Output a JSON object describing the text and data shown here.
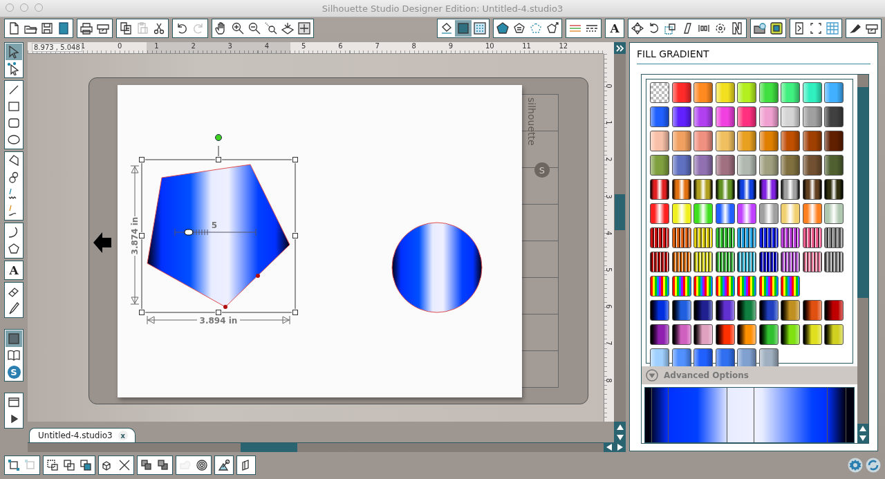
{
  "window": {
    "title": "Silhouette Studio Designer Edition: Untitled-4.studio3"
  },
  "toolbar": {
    "left_groups": [
      {
        "buttons": [
          {
            "kind": "new",
            "selected": false,
            "disabled": false
          },
          {
            "kind": "open",
            "selected": false,
            "disabled": false
          },
          {
            "kind": "save",
            "selected": false,
            "disabled": false
          },
          {
            "kind": "sd",
            "selected": false,
            "disabled": false
          }
        ]
      },
      {
        "buttons": [
          {
            "kind": "print",
            "selected": false,
            "disabled": false
          },
          {
            "kind": "cutter",
            "selected": false,
            "disabled": false
          }
        ]
      },
      {
        "buttons": [
          {
            "kind": "copy",
            "selected": false,
            "disabled": false
          },
          {
            "kind": "paste",
            "selected": false,
            "disabled": true
          },
          {
            "kind": "cut",
            "selected": false,
            "disabled": false
          }
        ]
      },
      {
        "buttons": [
          {
            "kind": "undo",
            "selected": false,
            "disabled": false
          },
          {
            "kind": "redo",
            "selected": false,
            "disabled": true
          }
        ]
      },
      {
        "buttons": [
          {
            "kind": "hand",
            "selected": false,
            "disabled": false
          },
          {
            "kind": "zoom_in",
            "selected": false,
            "disabled": false
          },
          {
            "kind": "zoom_out",
            "selected": false,
            "disabled": false
          },
          {
            "kind": "zoom_select",
            "selected": false,
            "disabled": false
          },
          {
            "kind": "zoom_fit",
            "selected": false,
            "disabled": false
          },
          {
            "kind": "fit_page",
            "selected": false,
            "disabled": false
          }
        ]
      }
    ],
    "right_groups": [
      {
        "buttons": [
          {
            "kind": "paint_bucket",
            "selected": false,
            "disabled": false
          },
          {
            "kind": "fill_gradient",
            "selected": true,
            "disabled": false
          },
          {
            "kind": "fill_pattern",
            "selected": false,
            "disabled": false
          }
        ]
      },
      {
        "buttons": [
          {
            "kind": "pentagon_fill",
            "selected": false,
            "disabled": false
          },
          {
            "kind": "pentagon_lines",
            "selected": false,
            "disabled": false
          },
          {
            "kind": "pentagon_dotted",
            "selected": false,
            "disabled": false
          },
          {
            "kind": "pentagon_arrow",
            "selected": false,
            "disabled": false
          }
        ]
      },
      {
        "buttons": [
          {
            "kind": "line_color",
            "selected": false,
            "disabled": false
          },
          {
            "kind": "line_style",
            "selected": false,
            "disabled": false
          }
        ]
      },
      {
        "buttons": [
          {
            "kind": "text_style",
            "label": "A",
            "selected": false,
            "disabled": false
          }
        ]
      },
      {
        "buttons": [
          {
            "kind": "move",
            "selected": false,
            "disabled": false
          },
          {
            "kind": "rotate",
            "selected": false,
            "disabled": false
          },
          {
            "kind": "scale",
            "selected": false,
            "disabled": false
          },
          {
            "kind": "shear",
            "selected": false,
            "disabled": false
          },
          {
            "kind": "align",
            "selected": false,
            "disabled": false
          },
          {
            "kind": "replicate",
            "selected": false,
            "disabled": false
          },
          {
            "kind": "nest",
            "selected": false,
            "disabled": false
          }
        ]
      },
      {
        "buttons": [
          {
            "kind": "library",
            "selected": false,
            "disabled": false
          },
          {
            "kind": "trace",
            "selected": false,
            "disabled": false
          }
        ]
      },
      {
        "buttons": [
          {
            "kind": "page_setup",
            "selected": false,
            "disabled": false
          },
          {
            "kind": "cut_settings",
            "selected": false,
            "disabled": false
          },
          {
            "kind": "grid",
            "selected": false,
            "disabled": false
          }
        ]
      },
      {
        "buttons": [
          {
            "kind": "marker",
            "selected": false,
            "disabled": false
          },
          {
            "kind": "send",
            "selected": false,
            "disabled": false
          }
        ]
      }
    ]
  },
  "left_toolbar": {
    "tools": [
      {
        "buttons": [
          {
            "kind": "select",
            "selected": true,
            "disabled": false
          },
          {
            "kind": "edit_points",
            "selected": false,
            "disabled": false
          }
        ]
      },
      {
        "buttons": [
          {
            "kind": "line_tool",
            "selected": false,
            "disabled": false
          },
          {
            "kind": "rect",
            "selected": false,
            "disabled": false
          },
          {
            "kind": "round_rect",
            "selected": false,
            "disabled": false
          },
          {
            "kind": "ellipse",
            "selected": false,
            "disabled": false
          }
        ]
      },
      {
        "buttons": [
          {
            "kind": "polygon_pen",
            "selected": false,
            "disabled": false
          },
          {
            "kind": "curve",
            "selected": false,
            "disabled": false
          },
          {
            "kind": "freehand",
            "selected": false,
            "disabled": false
          },
          {
            "kind": "smooth",
            "selected": false,
            "disabled": false
          }
        ]
      },
      {
        "buttons": [
          {
            "kind": "arc",
            "selected": false,
            "disabled": false
          },
          {
            "kind": "reg_polygon",
            "selected": false,
            "disabled": false
          }
        ]
      },
      {
        "buttons": [
          {
            "kind": "text_tool",
            "label": "A",
            "selected": false,
            "disabled": false
          }
        ]
      },
      {
        "buttons": [
          {
            "kind": "eraser",
            "selected": false,
            "disabled": false
          },
          {
            "kind": "knife",
            "selected": false,
            "disabled": false
          }
        ]
      }
    ],
    "views": [
      {
        "buttons": [
          {
            "kind": "design_area",
            "selected": true,
            "disabled": false
          },
          {
            "kind": "library_book",
            "selected": false,
            "disabled": false
          },
          {
            "kind": "store",
            "label": "S",
            "selected": false,
            "disabled": false
          }
        ]
      }
    ],
    "windows": [
      {
        "buttons": [
          {
            "kind": "window",
            "selected": false,
            "disabled": false
          },
          {
            "kind": "play",
            "selected": false,
            "disabled": false
          }
        ]
      }
    ]
  },
  "ruler": {
    "coordinates": "8.973 , 5.048",
    "x_labels": [
      "1",
      "0",
      "1",
      "2",
      "3",
      "4",
      "5",
      "6",
      "7",
      "8",
      "9",
      "10",
      "11",
      "12"
    ],
    "y_labels": [
      "0",
      "1",
      "2",
      "3",
      "4",
      "5",
      "6",
      "7",
      "8"
    ]
  },
  "canvas": {
    "mat_brand": "silhouette",
    "mat_logo": "S",
    "shapes": [
      {
        "kind": "pentagon",
        "selected": true
      },
      {
        "kind": "circle",
        "selected": false
      }
    ],
    "height_label": "3.874 in",
    "width_label": "3.894 in",
    "gradient_label": "5",
    "gradient_slider": {
      "level": 0.17
    }
  },
  "tabs": [
    {
      "label": "Untitled-4.studio3",
      "close": "x",
      "selected": true
    }
  ],
  "panel": {
    "title": "FILL GRADIENT",
    "swatch_rows": [
      {
        "swatches": [
          {
            "kind": "none"
          },
          {
            "kind": "plain",
            "color": "#ff2a2a"
          },
          {
            "kind": "plain",
            "color": "#ff8a20"
          },
          {
            "kind": "plain",
            "color": "#f2e020"
          },
          {
            "kind": "plain",
            "color": "#b4f020"
          },
          {
            "kind": "plain",
            "color": "#40e040"
          },
          {
            "kind": "plain",
            "color": "#40f080"
          },
          {
            "kind": "plain",
            "color": "#30f0c0"
          },
          {
            "kind": "plain",
            "color": "#40b0ff"
          }
        ]
      },
      {
        "swatches": [
          {
            "kind": "plain",
            "color": "#2060ff"
          },
          {
            "kind": "plain",
            "color": "#6020ff"
          },
          {
            "kind": "plain",
            "color": "#b040f0"
          },
          {
            "kind": "plain",
            "color": "#f040e0"
          },
          {
            "kind": "plain",
            "color": "#ff3080"
          },
          {
            "kind": "plain",
            "color": "#f0a0d0"
          },
          {
            "kind": "plain",
            "color": "#d4d4d4"
          },
          {
            "kind": "plain",
            "color": "#a0a0a0"
          },
          {
            "kind": "plain",
            "color": "#404040"
          }
        ]
      },
      {
        "swatches": [
          {
            "kind": "plain",
            "color": "#f8c0a8"
          },
          {
            "kind": "plain",
            "color": "#f0a060"
          },
          {
            "kind": "plain",
            "color": "#f09080"
          },
          {
            "kind": "plain",
            "color": "#f0c060"
          },
          {
            "kind": "plain",
            "color": "#e8a020"
          },
          {
            "kind": "plain",
            "color": "#e08000"
          },
          {
            "kind": "plain",
            "color": "#c05000"
          },
          {
            "kind": "plain",
            "color": "#a04000"
          },
          {
            "kind": "plain",
            "color": "#602000"
          }
        ]
      },
      {
        "swatches": [
          {
            "kind": "plain",
            "color": "#80a040"
          },
          {
            "kind": "plain",
            "color": "#6070c0"
          },
          {
            "kind": "plain",
            "color": "#9070b0"
          },
          {
            "kind": "plain",
            "color": "#a07080"
          },
          {
            "kind": "plain",
            "color": "#b0b8b0"
          },
          {
            "kind": "plain",
            "color": "#a0a080"
          },
          {
            "kind": "plain",
            "color": "#807040"
          },
          {
            "kind": "plain",
            "color": "#705030"
          },
          {
            "kind": "plain",
            "color": "#506030"
          }
        ]
      },
      {
        "swatches": [
          {
            "kind": "band",
            "color": "#e02020"
          },
          {
            "kind": "band",
            "color": "#e07010"
          },
          {
            "kind": "band",
            "color": "#b0a020"
          },
          {
            "kind": "band",
            "color": "#609020"
          },
          {
            "kind": "band",
            "color": "#1040e0"
          },
          {
            "kind": "band",
            "color": "#8020e0"
          },
          {
            "kind": "band",
            "color": "#a0a0a0"
          },
          {
            "kind": "band",
            "color": "#604020"
          },
          {
            "kind": "band",
            "color": "#303010"
          }
        ]
      },
      {
        "swatches": [
          {
            "kind": "glossy",
            "color": "#ff2020"
          },
          {
            "kind": "glossy",
            "color": "#f0f020"
          },
          {
            "kind": "glossy",
            "color": "#40e020"
          },
          {
            "kind": "glossy",
            "color": "#2060ff"
          },
          {
            "kind": "glossy",
            "color": "#c040ff"
          },
          {
            "kind": "glossy",
            "color": "#a0a0a0"
          },
          {
            "kind": "glossy",
            "color": "#f0d070"
          },
          {
            "kind": "glossy",
            "color": "#ff8020"
          },
          {
            "kind": "glossy",
            "color": "#b0c8b0"
          }
        ]
      },
      {
        "swatches": [
          {
            "kind": "stripe",
            "color": "#d01010"
          },
          {
            "kind": "stripe",
            "color": "#e06010"
          },
          {
            "kind": "stripe",
            "color": "#e0d010"
          },
          {
            "kind": "stripe",
            "color": "#30c030"
          },
          {
            "kind": "stripe",
            "color": "#20a0e0"
          },
          {
            "kind": "stripe",
            "color": "#1020e0"
          },
          {
            "kind": "stripe",
            "color": "#c040e0"
          },
          {
            "kind": "stripe",
            "color": "#f06090"
          },
          {
            "kind": "stripe",
            "color": "#808080"
          }
        ]
      },
      {
        "swatches": [
          {
            "kind": "fine_stripe",
            "color": "#c01010"
          },
          {
            "kind": "fine_stripe",
            "color": "#e07010"
          },
          {
            "kind": "fine_stripe",
            "color": "#e0e020"
          },
          {
            "kind": "fine_stripe",
            "color": "#40c040"
          },
          {
            "kind": "fine_stripe",
            "color": "#40c0e0"
          },
          {
            "kind": "fine_stripe",
            "color": "#1010d0"
          },
          {
            "kind": "fine_stripe",
            "color": "#c060e0"
          },
          {
            "kind": "fine_stripe",
            "color": "#f080a0"
          },
          {
            "kind": "fine_stripe",
            "color": "#909090"
          }
        ]
      },
      {
        "swatches": [
          {
            "kind": "rainbow"
          },
          {
            "kind": "rainbow"
          },
          {
            "kind": "rainbow"
          },
          {
            "kind": "rainbow"
          },
          {
            "kind": "rainbow"
          },
          {
            "kind": "rainbow"
          },
          {
            "kind": "rainbow"
          }
        ]
      },
      {
        "swatches": [
          {
            "kind": "duo",
            "color": "#0030e0"
          },
          {
            "kind": "duo",
            "color": "#2060e0"
          },
          {
            "kind": "duo",
            "color": "#202090"
          },
          {
            "kind": "duo",
            "color": "#6030d0"
          },
          {
            "kind": "duo",
            "color": "#108040"
          },
          {
            "kind": "duo",
            "color": "#2040c0"
          },
          {
            "kind": "duo",
            "color": "#c09020"
          },
          {
            "kind": "duo",
            "color": "#e05010"
          },
          {
            "kind": "duo",
            "color": "#c00000"
          }
        ]
      },
      {
        "swatches": [
          {
            "kind": "duo",
            "color": "#9020b0"
          },
          {
            "kind": "duo",
            "color": "#d060c0"
          },
          {
            "kind": "duo",
            "color": "#e0a0c0"
          },
          {
            "kind": "duo",
            "color": "#ff3000"
          },
          {
            "kind": "duo",
            "color": "#ff9000"
          },
          {
            "kind": "duo",
            "color": "#30c030"
          },
          {
            "kind": "duo",
            "color": "#80e010"
          },
          {
            "kind": "duo",
            "color": "#e0e020"
          },
          {
            "kind": "duo",
            "color": "#d0d020"
          }
        ]
      },
      {
        "swatches": [
          {
            "kind": "plain",
            "color": "#a0d0ff"
          },
          {
            "kind": "plain",
            "color": "#5090ff"
          },
          {
            "kind": "plain",
            "color": "#2060ff"
          },
          {
            "kind": "plain",
            "color": "#3070f0"
          },
          {
            "kind": "plain",
            "color": "#80a0d0"
          },
          {
            "kind": "plain",
            "color": "#a0b0c0"
          }
        ]
      }
    ],
    "advanced_label": "Advanced Options"
  },
  "bottom_toolbar": {
    "groups": [
      {
        "buttons": [
          {
            "kind": "group",
            "selected": false,
            "disabled": false
          },
          {
            "kind": "ungroup",
            "selected": false,
            "disabled": true
          }
        ]
      },
      {
        "buttons": [
          {
            "kind": "compound",
            "selected": false,
            "disabled": false
          },
          {
            "kind": "release",
            "selected": false,
            "disabled": false
          },
          {
            "kind": "merge",
            "selected": false,
            "disabled": false
          }
        ]
      },
      {
        "buttons": [
          {
            "kind": "weld",
            "selected": false,
            "disabled": false
          },
          {
            "kind": "cross",
            "selected": false,
            "disabled": false
          }
        ]
      },
      {
        "buttons": [
          {
            "kind": "forward",
            "selected": false,
            "disabled": false
          },
          {
            "kind": "backward",
            "selected": false,
            "disabled": false
          }
        ]
      },
      {
        "buttons": [
          {
            "kind": "shape",
            "selected": false,
            "disabled": true
          },
          {
            "kind": "rings",
            "selected": false,
            "disabled": false
          }
        ]
      },
      {
        "buttons": [
          {
            "kind": "pin",
            "selected": false,
            "disabled": false
          }
        ]
      },
      {
        "buttons": [
          {
            "kind": "layers",
            "selected": false,
            "disabled": false
          }
        ]
      }
    ]
  }
}
